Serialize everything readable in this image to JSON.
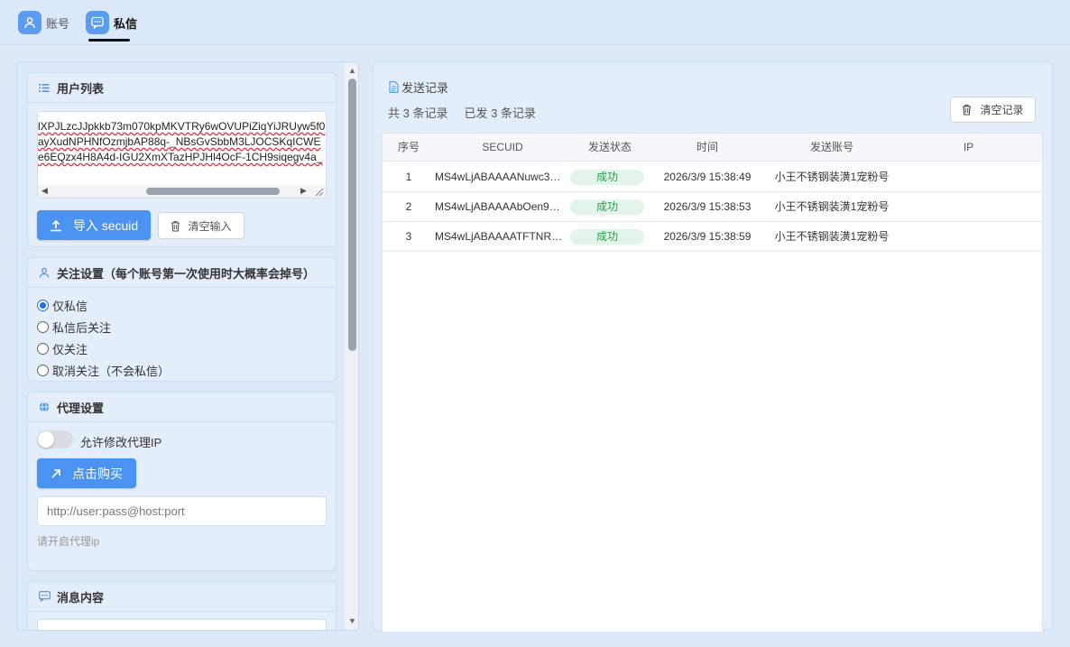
{
  "nav": {
    "tabs": [
      {
        "label": "账号",
        "icon": "user-icon"
      },
      {
        "label": "私信",
        "icon": "chat-icon",
        "active": true
      }
    ]
  },
  "user_list": {
    "title": "用户列表",
    "lines": [
      "lXPJLzcJJpkkb73m070kpMKVTRy6wOVUPiZiqYiJRUyw5f0",
      "ayXudNPHNfOzmjbAP88q-_NBsGvSbbM3LJOCSKqICWE",
      "e6EQzx4H8A4d-IGU2XmXTazHPJHl4OcF-1CH9siqegv4a_"
    ],
    "import_button": "导入 secuid",
    "clear_button": "清空输入"
  },
  "follow": {
    "title": "关注设置（每个账号第一次使用时大概率会掉号）",
    "options": [
      "仅私信",
      "私信后关注",
      "仅关注",
      "取消关注（不会私信）"
    ],
    "selected": "仅私信"
  },
  "proxy": {
    "title": "代理设置",
    "toggle_label": "允许修改代理IP",
    "toggle_on": false,
    "buy_button": "点击购买",
    "input_placeholder": "http://user:pass@host:port",
    "hint": "请开启代理ip"
  },
  "message": {
    "title": "消息内容"
  },
  "records": {
    "title": "发送记录",
    "total": "共 3 条记录",
    "sent": "已发 3 条记录",
    "clear_button": "清空记录",
    "columns": [
      "序号",
      "SECUID",
      "发送状态",
      "时间",
      "发送账号",
      "IP"
    ],
    "rows": [
      {
        "index": "1",
        "secuid": "MS4wLjABAAAANuwc3e...",
        "status": "成功",
        "time": "2026/3/9 15:38:49",
        "account": "小王不锈钢装潢1宠粉号",
        "ip": ""
      },
      {
        "index": "2",
        "secuid": "MS4wLjABAAAAbOen90...",
        "status": "成功",
        "time": "2026/3/9 15:38:53",
        "account": "小王不锈钢装潢1宠粉号",
        "ip": ""
      },
      {
        "index": "3",
        "secuid": "MS4wLjABAAAATFTNRtx...",
        "status": "成功",
        "time": "2026/3/9 15:38:59",
        "account": "小王不锈钢装潢1宠粉号",
        "ip": ""
      }
    ]
  },
  "colors": {
    "accent": "#4b93f0",
    "success_text": "#2e9e4f",
    "success_bg": "#e3f5e8",
    "background": "#dde9f8"
  }
}
